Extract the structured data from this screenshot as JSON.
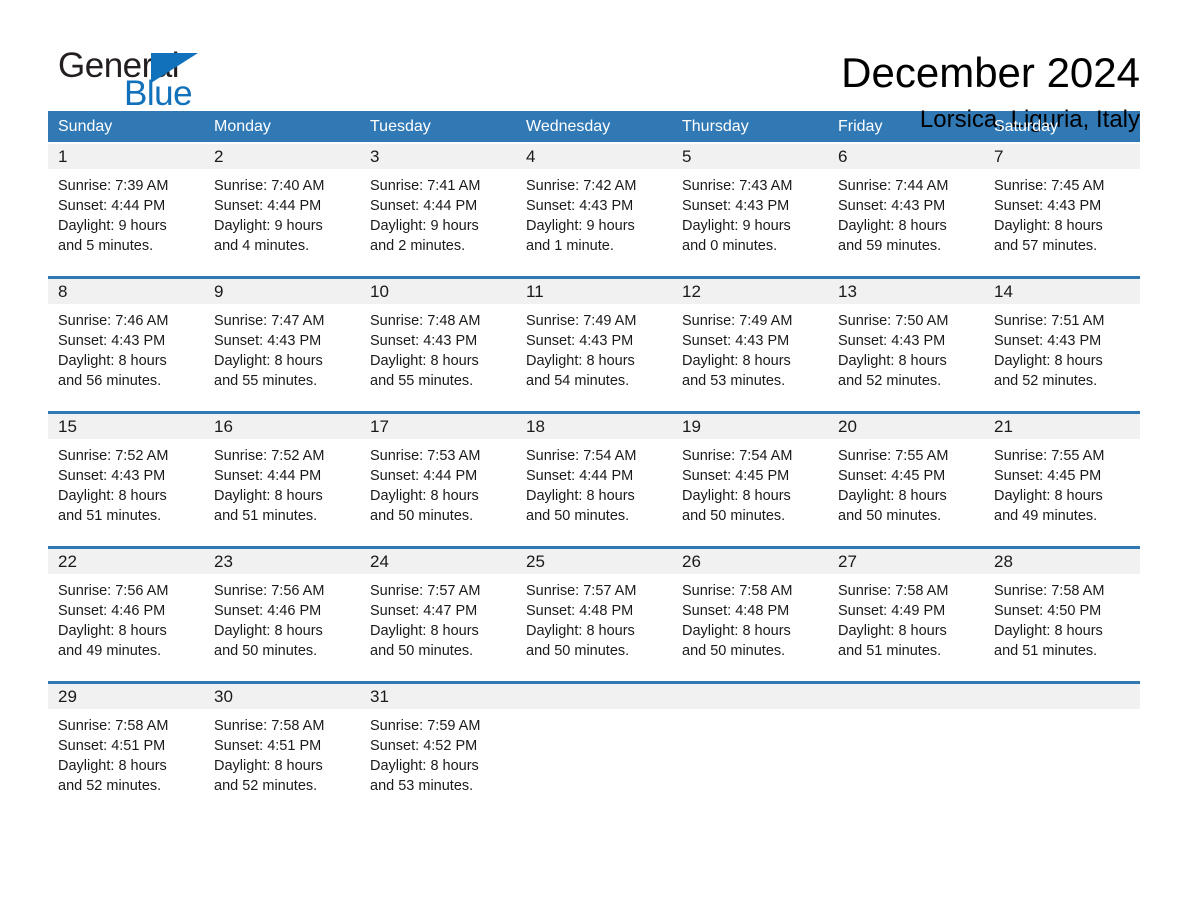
{
  "brand": {
    "name_part1": "General",
    "name_part2": "Blue",
    "logo_icon": "triangle-flag-icon",
    "accent_color": "#1271bb"
  },
  "header": {
    "title": "December 2024",
    "subtitle": "Lorsica, Liguria, Italy"
  },
  "colors": {
    "header_blue": "#3179b5",
    "day_band_gray": "#f1f1f1",
    "text": "#1a1a1a"
  },
  "calendar": {
    "weekdays": [
      "Sunday",
      "Monday",
      "Tuesday",
      "Wednesday",
      "Thursday",
      "Friday",
      "Saturday"
    ],
    "weeks": [
      [
        {
          "day": "1",
          "sunrise": "Sunrise: 7:39 AM",
          "sunset": "Sunset: 4:44 PM",
          "daylight_line1": "Daylight: 9 hours",
          "daylight_line2": "and 5 minutes."
        },
        {
          "day": "2",
          "sunrise": "Sunrise: 7:40 AM",
          "sunset": "Sunset: 4:44 PM",
          "daylight_line1": "Daylight: 9 hours",
          "daylight_line2": "and 4 minutes."
        },
        {
          "day": "3",
          "sunrise": "Sunrise: 7:41 AM",
          "sunset": "Sunset: 4:44 PM",
          "daylight_line1": "Daylight: 9 hours",
          "daylight_line2": "and 2 minutes."
        },
        {
          "day": "4",
          "sunrise": "Sunrise: 7:42 AM",
          "sunset": "Sunset: 4:43 PM",
          "daylight_line1": "Daylight: 9 hours",
          "daylight_line2": "and 1 minute."
        },
        {
          "day": "5",
          "sunrise": "Sunrise: 7:43 AM",
          "sunset": "Sunset: 4:43 PM",
          "daylight_line1": "Daylight: 9 hours",
          "daylight_line2": "and 0 minutes."
        },
        {
          "day": "6",
          "sunrise": "Sunrise: 7:44 AM",
          "sunset": "Sunset: 4:43 PM",
          "daylight_line1": "Daylight: 8 hours",
          "daylight_line2": "and 59 minutes."
        },
        {
          "day": "7",
          "sunrise": "Sunrise: 7:45 AM",
          "sunset": "Sunset: 4:43 PM",
          "daylight_line1": "Daylight: 8 hours",
          "daylight_line2": "and 57 minutes."
        }
      ],
      [
        {
          "day": "8",
          "sunrise": "Sunrise: 7:46 AM",
          "sunset": "Sunset: 4:43 PM",
          "daylight_line1": "Daylight: 8 hours",
          "daylight_line2": "and 56 minutes."
        },
        {
          "day": "9",
          "sunrise": "Sunrise: 7:47 AM",
          "sunset": "Sunset: 4:43 PM",
          "daylight_line1": "Daylight: 8 hours",
          "daylight_line2": "and 55 minutes."
        },
        {
          "day": "10",
          "sunrise": "Sunrise: 7:48 AM",
          "sunset": "Sunset: 4:43 PM",
          "daylight_line1": "Daylight: 8 hours",
          "daylight_line2": "and 55 minutes."
        },
        {
          "day": "11",
          "sunrise": "Sunrise: 7:49 AM",
          "sunset": "Sunset: 4:43 PM",
          "daylight_line1": "Daylight: 8 hours",
          "daylight_line2": "and 54 minutes."
        },
        {
          "day": "12",
          "sunrise": "Sunrise: 7:49 AM",
          "sunset": "Sunset: 4:43 PM",
          "daylight_line1": "Daylight: 8 hours",
          "daylight_line2": "and 53 minutes."
        },
        {
          "day": "13",
          "sunrise": "Sunrise: 7:50 AM",
          "sunset": "Sunset: 4:43 PM",
          "daylight_line1": "Daylight: 8 hours",
          "daylight_line2": "and 52 minutes."
        },
        {
          "day": "14",
          "sunrise": "Sunrise: 7:51 AM",
          "sunset": "Sunset: 4:43 PM",
          "daylight_line1": "Daylight: 8 hours",
          "daylight_line2": "and 52 minutes."
        }
      ],
      [
        {
          "day": "15",
          "sunrise": "Sunrise: 7:52 AM",
          "sunset": "Sunset: 4:43 PM",
          "daylight_line1": "Daylight: 8 hours",
          "daylight_line2": "and 51 minutes."
        },
        {
          "day": "16",
          "sunrise": "Sunrise: 7:52 AM",
          "sunset": "Sunset: 4:44 PM",
          "daylight_line1": "Daylight: 8 hours",
          "daylight_line2": "and 51 minutes."
        },
        {
          "day": "17",
          "sunrise": "Sunrise: 7:53 AM",
          "sunset": "Sunset: 4:44 PM",
          "daylight_line1": "Daylight: 8 hours",
          "daylight_line2": "and 50 minutes."
        },
        {
          "day": "18",
          "sunrise": "Sunrise: 7:54 AM",
          "sunset": "Sunset: 4:44 PM",
          "daylight_line1": "Daylight: 8 hours",
          "daylight_line2": "and 50 minutes."
        },
        {
          "day": "19",
          "sunrise": "Sunrise: 7:54 AM",
          "sunset": "Sunset: 4:45 PM",
          "daylight_line1": "Daylight: 8 hours",
          "daylight_line2": "and 50 minutes."
        },
        {
          "day": "20",
          "sunrise": "Sunrise: 7:55 AM",
          "sunset": "Sunset: 4:45 PM",
          "daylight_line1": "Daylight: 8 hours",
          "daylight_line2": "and 50 minutes."
        },
        {
          "day": "21",
          "sunrise": "Sunrise: 7:55 AM",
          "sunset": "Sunset: 4:45 PM",
          "daylight_line1": "Daylight: 8 hours",
          "daylight_line2": "and 49 minutes."
        }
      ],
      [
        {
          "day": "22",
          "sunrise": "Sunrise: 7:56 AM",
          "sunset": "Sunset: 4:46 PM",
          "daylight_line1": "Daylight: 8 hours",
          "daylight_line2": "and 49 minutes."
        },
        {
          "day": "23",
          "sunrise": "Sunrise: 7:56 AM",
          "sunset": "Sunset: 4:46 PM",
          "daylight_line1": "Daylight: 8 hours",
          "daylight_line2": "and 50 minutes."
        },
        {
          "day": "24",
          "sunrise": "Sunrise: 7:57 AM",
          "sunset": "Sunset: 4:47 PM",
          "daylight_line1": "Daylight: 8 hours",
          "daylight_line2": "and 50 minutes."
        },
        {
          "day": "25",
          "sunrise": "Sunrise: 7:57 AM",
          "sunset": "Sunset: 4:48 PM",
          "daylight_line1": "Daylight: 8 hours",
          "daylight_line2": "and 50 minutes."
        },
        {
          "day": "26",
          "sunrise": "Sunrise: 7:58 AM",
          "sunset": "Sunset: 4:48 PM",
          "daylight_line1": "Daylight: 8 hours",
          "daylight_line2": "and 50 minutes."
        },
        {
          "day": "27",
          "sunrise": "Sunrise: 7:58 AM",
          "sunset": "Sunset: 4:49 PM",
          "daylight_line1": "Daylight: 8 hours",
          "daylight_line2": "and 51 minutes."
        },
        {
          "day": "28",
          "sunrise": "Sunrise: 7:58 AM",
          "sunset": "Sunset: 4:50 PM",
          "daylight_line1": "Daylight: 8 hours",
          "daylight_line2": "and 51 minutes."
        }
      ],
      [
        {
          "day": "29",
          "sunrise": "Sunrise: 7:58 AM",
          "sunset": "Sunset: 4:51 PM",
          "daylight_line1": "Daylight: 8 hours",
          "daylight_line2": "and 52 minutes."
        },
        {
          "day": "30",
          "sunrise": "Sunrise: 7:58 AM",
          "sunset": "Sunset: 4:51 PM",
          "daylight_line1": "Daylight: 8 hours",
          "daylight_line2": "and 52 minutes."
        },
        {
          "day": "31",
          "sunrise": "Sunrise: 7:59 AM",
          "sunset": "Sunset: 4:52 PM",
          "daylight_line1": "Daylight: 8 hours",
          "daylight_line2": "and 53 minutes."
        },
        {
          "day": "",
          "sunrise": "",
          "sunset": "",
          "daylight_line1": "",
          "daylight_line2": ""
        },
        {
          "day": "",
          "sunrise": "",
          "sunset": "",
          "daylight_line1": "",
          "daylight_line2": ""
        },
        {
          "day": "",
          "sunrise": "",
          "sunset": "",
          "daylight_line1": "",
          "daylight_line2": ""
        },
        {
          "day": "",
          "sunrise": "",
          "sunset": "",
          "daylight_line1": "",
          "daylight_line2": ""
        }
      ]
    ]
  }
}
